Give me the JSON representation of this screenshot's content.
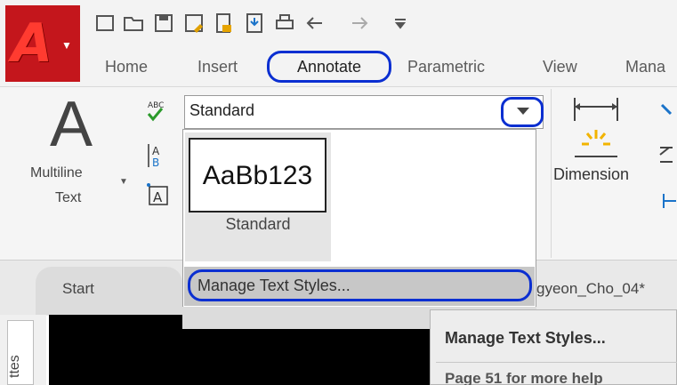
{
  "app": {
    "button_letter": "A",
    "brand_color": "#c4161c",
    "accent_color": "#0b2fd1"
  },
  "quick_access": {
    "icons": [
      "new-file-icon",
      "open-folder-icon",
      "save-icon",
      "save-as-icon",
      "import-icon",
      "export-icon",
      "print-icon",
      "undo-icon",
      "redo-icon",
      "customize-icon"
    ]
  },
  "tabs": [
    {
      "label": "Home"
    },
    {
      "label": "Insert"
    },
    {
      "label": "Annotate"
    },
    {
      "label": "Parametric"
    },
    {
      "label": "View"
    },
    {
      "label": "Mana"
    }
  ],
  "ribbon": {
    "multiline_line1": "Multiline",
    "multiline_line2": "Text",
    "text_style_value": "Standard",
    "dimension_label": "Dimension"
  },
  "dropdown": {
    "swatch_preview": "AaBb123",
    "swatch_label": "Standard",
    "manage_label": "Manage Text Styles..."
  },
  "doc_tabs": {
    "start": "Start",
    "drawing": "gyeon_Cho_04*"
  },
  "palette": {
    "label": "ttes"
  },
  "tooltip": {
    "title": "Manage Text Styles...",
    "description": "Page 51 for more help"
  }
}
